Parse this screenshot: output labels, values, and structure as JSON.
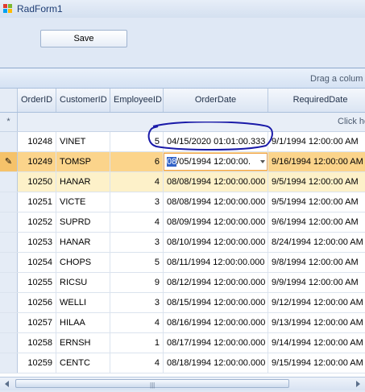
{
  "window": {
    "title": "RadForm1"
  },
  "toolbar": {
    "save_label": "Save"
  },
  "grid": {
    "group_panel_text": "Drag a colum",
    "new_row_text": "Click he",
    "new_row_marker": "*",
    "current_row_marker": "✎",
    "columns": [
      "OrderID",
      "CustomerID",
      "EmployeeID",
      "OrderDate",
      "RequiredDate"
    ],
    "editor_value_highlight": "08",
    "editor_value_rest": "/05/1994 12:00:00.",
    "rows": [
      {
        "order_id": "10248",
        "customer_id": "VINET",
        "employee_id": "5",
        "order_date": "04/15/2020 01:01:00.333",
        "required_date": "9/1/1994 12:00:00 AM"
      },
      {
        "order_id": "10249",
        "customer_id": "TOMSP",
        "employee_id": "6",
        "order_date": "08/05/1994 12:00:00.",
        "required_date": "9/16/1994 12:00:00 AM"
      },
      {
        "order_id": "10250",
        "customer_id": "HANAR",
        "employee_id": "4",
        "order_date": "08/08/1994 12:00:00.000",
        "required_date": "9/5/1994 12:00:00 AM"
      },
      {
        "order_id": "10251",
        "customer_id": "VICTE",
        "employee_id": "3",
        "order_date": "08/08/1994 12:00:00.000",
        "required_date": "9/5/1994 12:00:00 AM"
      },
      {
        "order_id": "10252",
        "customer_id": "SUPRD",
        "employee_id": "4",
        "order_date": "08/09/1994 12:00:00.000",
        "required_date": "9/6/1994 12:00:00 AM"
      },
      {
        "order_id": "10253",
        "customer_id": "HANAR",
        "employee_id": "3",
        "order_date": "08/10/1994 12:00:00.000",
        "required_date": "8/24/1994 12:00:00 AM"
      },
      {
        "order_id": "10254",
        "customer_id": "CHOPS",
        "employee_id": "5",
        "order_date": "08/11/1994 12:00:00.000",
        "required_date": "9/8/1994 12:00:00 AM"
      },
      {
        "order_id": "10255",
        "customer_id": "RICSU",
        "employee_id": "9",
        "order_date": "08/12/1994 12:00:00.000",
        "required_date": "9/9/1994 12:00:00 AM"
      },
      {
        "order_id": "10256",
        "customer_id": "WELLI",
        "employee_id": "3",
        "order_date": "08/15/1994 12:00:00.000",
        "required_date": "9/12/1994 12:00:00 AM"
      },
      {
        "order_id": "10257",
        "customer_id": "HILAA",
        "employee_id": "4",
        "order_date": "08/16/1994 12:00:00.000",
        "required_date": "9/13/1994 12:00:00 AM"
      },
      {
        "order_id": "10258",
        "customer_id": "ERNSH",
        "employee_id": "1",
        "order_date": "08/17/1994 12:00:00.000",
        "required_date": "9/14/1994 12:00:00 AM"
      },
      {
        "order_id": "10259",
        "customer_id": "CENTC",
        "employee_id": "4",
        "order_date": "08/18/1994 12:00:00.000",
        "required_date": "9/15/1994 12:00:00 AM"
      }
    ]
  },
  "colors": {
    "current_row": "#fbd48b",
    "selected_row": "#fdf1c9",
    "editor_border": "#f0a44b",
    "annotation": "#1a1aa8"
  }
}
